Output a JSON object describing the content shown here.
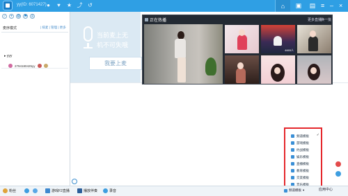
{
  "titlebar": {
    "room_title": "yy(ID: 6071427)",
    "icons": [
      "user-icon",
      "heart-icon",
      "star-icon",
      "share-icon",
      "back-icon"
    ],
    "home_icon": "home-icon",
    "game_icon": "gamepad-icon",
    "window_controls": {
      "menu": "≡",
      "minimize": "–",
      "close": "×"
    }
  },
  "left": {
    "mode_label": "麦序模式",
    "mode_links": "| 排麦 | 管理 | 更多",
    "mic_user": "▸ yyy",
    "mic_sub_user": "2794180425yy"
  },
  "main": {
    "hint_line1": "当前麦上无",
    "hint_line2": "机不可失哦",
    "go_on_mic": "我要上麦"
  },
  "live_popup": {
    "title": "正在热播",
    "more": "更多直播",
    "swap": "换一批",
    "thumbs": [
      {
        "label": ""
      },
      {
        "label": "4665人"
      },
      {
        "label": ""
      },
      {
        "label": ""
      },
      {
        "label": ""
      },
      {
        "label": ""
      }
    ]
  },
  "mode_menu": {
    "items": [
      {
        "label": "频道模板",
        "checked": true
      },
      {
        "label": "游戏模板",
        "checked": false
      },
      {
        "label": "约战模板",
        "checked": false
      },
      {
        "label": "娱乐模板",
        "checked": false
      },
      {
        "label": "直播模板",
        "checked": false
      },
      {
        "label": "教育模板",
        "checked": false
      },
      {
        "label": "交友模板",
        "checked": false
      },
      {
        "label": "音乐模板",
        "checked": false
      }
    ],
    "current_label": "频道模板"
  },
  "bottombar": {
    "invite": "粉丝",
    "camera": "拍照",
    "plugin": "游戏F2直播",
    "music": "播放伴奏",
    "record": "录音",
    "app_center": "应用中心"
  },
  "colors": {
    "title_blue": "#2f9fe4",
    "highlight_red": "#e5262b",
    "band_blue": "#dbe9f3"
  }
}
